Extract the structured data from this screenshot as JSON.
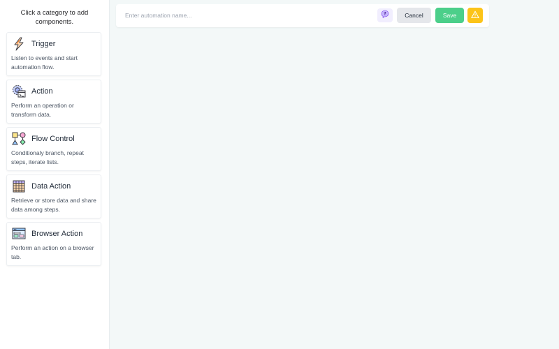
{
  "sidebar": {
    "hint": "Click a category to add components.",
    "categories": [
      {
        "title": "Trigger",
        "description": "Listen to events and start automation flow.",
        "icon": "lightning-icon"
      },
      {
        "title": "Action",
        "description": "Perform an operation or transform data.",
        "icon": "gear-window-icon"
      },
      {
        "title": "Flow Control",
        "description": "Conditionaly branch, repeat steps, iterate lists.",
        "icon": "flowchart-icon"
      },
      {
        "title": "Data Action",
        "description": "Retrieve or store data and share data among steps.",
        "icon": "table-grid-icon"
      },
      {
        "title": "Browser Action",
        "description": "Perform an action on a browser tab.",
        "icon": "browser-window-icon"
      }
    ]
  },
  "toolbar": {
    "name_placeholder": "Enter automation name...",
    "name_value": "",
    "help_icon": "question-bubble-icon",
    "cancel_label": "Cancel",
    "save_label": "Save",
    "warning_icon": "warning-triangle-icon"
  },
  "colors": {
    "canvas_bg": "#f3f8f8",
    "save": "#4ccf8a",
    "cancel": "#e5e7eb",
    "warning": "#fcc419",
    "help": "#f1eefe"
  }
}
